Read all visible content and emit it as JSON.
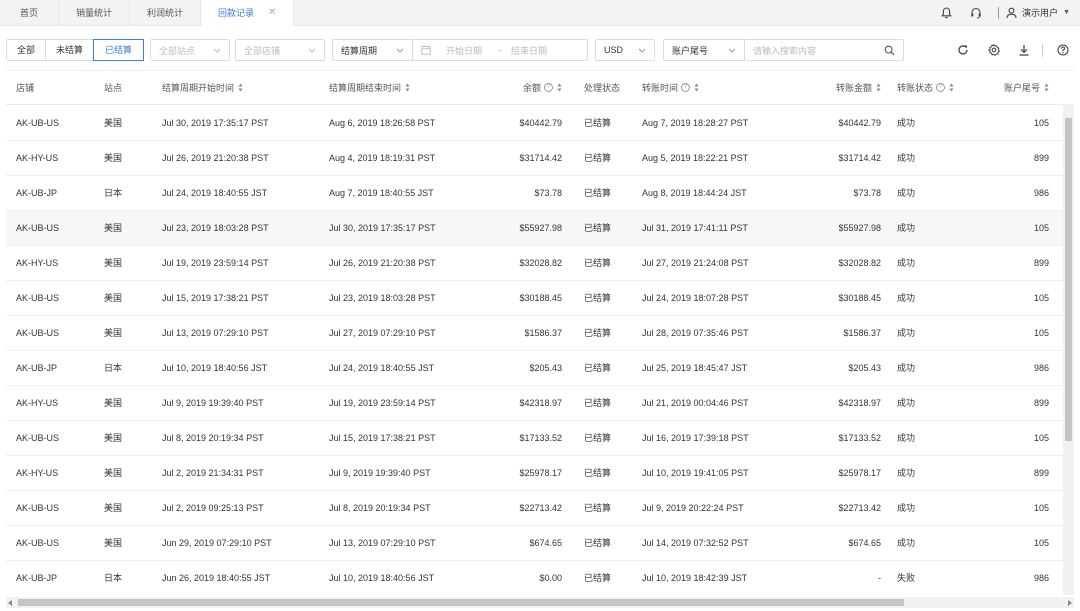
{
  "tabs": [
    {
      "label": "首页",
      "active": false
    },
    {
      "label": "销量统计",
      "active": false
    },
    {
      "label": "利润统计",
      "active": false
    },
    {
      "label": "回款记录",
      "active": true
    }
  ],
  "header": {
    "user_name": "演示用户"
  },
  "filters": {
    "status_segments": [
      "全部",
      "未结算",
      "已结算"
    ],
    "active_status": "已结算",
    "site_placeholder": "全部站点",
    "store_placeholder": "全部店铺",
    "period_label": "结算周期",
    "start_date_placeholder": "开始日期",
    "date_separator": "-",
    "end_date_placeholder": "结束日期",
    "currency": "USD",
    "search_field_label": "账户尾号",
    "search_placeholder": "请输入搜索内容"
  },
  "table": {
    "columns": [
      "店铺",
      "站点",
      "结算周期开始时间",
      "结算周期结束时间",
      "余额",
      "处理状态",
      "转账时间",
      "转账金额",
      "转账状态",
      "账户尾号"
    ],
    "rows": [
      [
        "AK-UB-US",
        "美国",
        "Jul 30, 2019 17:35:17 PST",
        "Aug 6, 2019 18:26:58 PST",
        "$40442.79",
        "已结算",
        "Aug 7, 2019 18:28:27 PST",
        "$40442.79",
        "成功",
        "105"
      ],
      [
        "AK-HY-US",
        "美国",
        "Jul 26, 2019 21:20:38 PST",
        "Aug 4, 2019 18:19:31 PST",
        "$31714.42",
        "已结算",
        "Aug 5, 2019 18:22:21 PST",
        "$31714.42",
        "成功",
        "899"
      ],
      [
        "AK-UB-JP",
        "日本",
        "Jul 24, 2019 18:40:55 JST",
        "Aug 7, 2019 18:40:55 JST",
        "$73.78",
        "已结算",
        "Aug 8, 2019 18:44:24 JST",
        "$73.78",
        "成功",
        "986"
      ],
      [
        "AK-UB-US",
        "美国",
        "Jul 23, 2019 18:03:28 PST",
        "Jul 30, 2019 17:35:17 PST",
        "$55927.98",
        "已结算",
        "Jul 31, 2019 17:41:11 PST",
        "$55927.98",
        "成功",
        "105"
      ],
      [
        "AK-HY-US",
        "美国",
        "Jul 19, 2019 23:59:14 PST",
        "Jul 26, 2019 21:20:38 PST",
        "$32028.82",
        "已结算",
        "Jul 27, 2019 21:24:08 PST",
        "$32028.82",
        "成功",
        "899"
      ],
      [
        "AK-UB-US",
        "美国",
        "Jul 15, 2019 17:38:21 PST",
        "Jul 23, 2019 18:03:28 PST",
        "$30188.45",
        "已结算",
        "Jul 24, 2019 18:07:28 PST",
        "$30188.45",
        "成功",
        "105"
      ],
      [
        "AK-UB-US",
        "美国",
        "Jul 13, 2019 07:29:10 PST",
        "Jul 27, 2019 07:29:10 PST",
        "$1586.37",
        "已结算",
        "Jul 28, 2019 07:35:46 PST",
        "$1586.37",
        "成功",
        "105"
      ],
      [
        "AK-UB-JP",
        "日本",
        "Jul 10, 2019 18:40:56 JST",
        "Jul 24, 2019 18:40:55 JST",
        "$205.43",
        "已结算",
        "Jul 25, 2019 18:45:47 JST",
        "$205.43",
        "成功",
        "986"
      ],
      [
        "AK-HY-US",
        "美国",
        "Jul 9, 2019 19:39:40 PST",
        "Jul 19, 2019 23:59:14 PST",
        "$42318.97",
        "已结算",
        "Jul 21, 2019 00:04:46 PST",
        "$42318.97",
        "成功",
        "899"
      ],
      [
        "AK-UB-US",
        "美国",
        "Jul 8, 2019 20:19:34 PST",
        "Jul 15, 2019 17:38:21 PST",
        "$17133.52",
        "已结算",
        "Jul 16, 2019 17:39:18 PST",
        "$17133.52",
        "成功",
        "105"
      ],
      [
        "AK-HY-US",
        "美国",
        "Jul 2, 2019 21:34:31 PST",
        "Jul 9, 2019 19:39:40 PST",
        "$25978.17",
        "已结算",
        "Jul 10, 2019 19:41:05 PST",
        "$25978.17",
        "成功",
        "899"
      ],
      [
        "AK-UB-US",
        "美国",
        "Jul 2, 2019 09:25:13 PST",
        "Jul 8, 2019 20:19:34 PST",
        "$22713.42",
        "已结算",
        "Jul 9, 2019 20:22:24 PST",
        "$22713.42",
        "成功",
        "105"
      ],
      [
        "AK-UB-US",
        "美国",
        "Jun 29, 2019 07:29:10 PST",
        "Jul 13, 2019 07:29:10 PST",
        "$674.65",
        "已结算",
        "Jul 14, 2019 07:32:52 PST",
        "$674.65",
        "成功",
        "105"
      ],
      [
        "AK-UB-JP",
        "日本",
        "Jun 26, 2019 18:40:55 JST",
        "Jul 10, 2019 18:40:56 JST",
        "$0.00",
        "已结算",
        "Jul 10, 2019 18:42:39 JST",
        "-",
        "失败",
        "986"
      ]
    ]
  },
  "colors": {
    "accent": "#3b7ddd",
    "tabbar_bg": "#f2f3f5",
    "row_hover": "#f6f7f9"
  },
  "icons": {
    "bell": "bell-icon",
    "headset": "headset-icon",
    "user": "user-icon",
    "refresh": "refresh-icon",
    "settings": "gear-icon",
    "download": "download-icon",
    "help": "help-icon",
    "search": "search-icon",
    "calendar": "calendar-icon"
  }
}
